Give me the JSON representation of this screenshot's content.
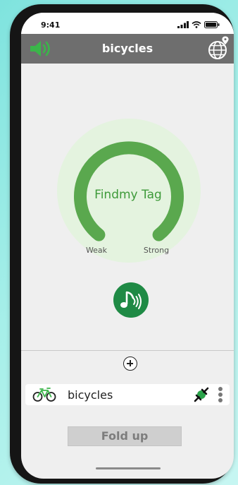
{
  "status_bar": {
    "time": "9:41",
    "icons": [
      "signal-icon",
      "wifi-icon",
      "battery-icon"
    ]
  },
  "header": {
    "title": "bicycles",
    "left_icon": "speaker-icon",
    "right_icon": "globe-location-icon"
  },
  "gauge": {
    "title": "Findmy Tag",
    "weak_label": "Weak",
    "strong_label": "Strong",
    "signal_fraction": 1.0
  },
  "play_sound_button": {
    "icon": "music-note-sound-icon"
  },
  "add_button": {
    "icon": "plus-circle-icon"
  },
  "device": {
    "name": "bicycles",
    "icon": "bicycle-icon",
    "link_icon": "link-icon",
    "menu_icon": "more-vertical-icon"
  },
  "fold_button": {
    "label": "Fold up"
  },
  "colors": {
    "accent_green": "#5aa84e",
    "dark_green": "#1f8a45",
    "header_gray": "#6e6e6e",
    "gauge_glow": "#e4f3df"
  }
}
